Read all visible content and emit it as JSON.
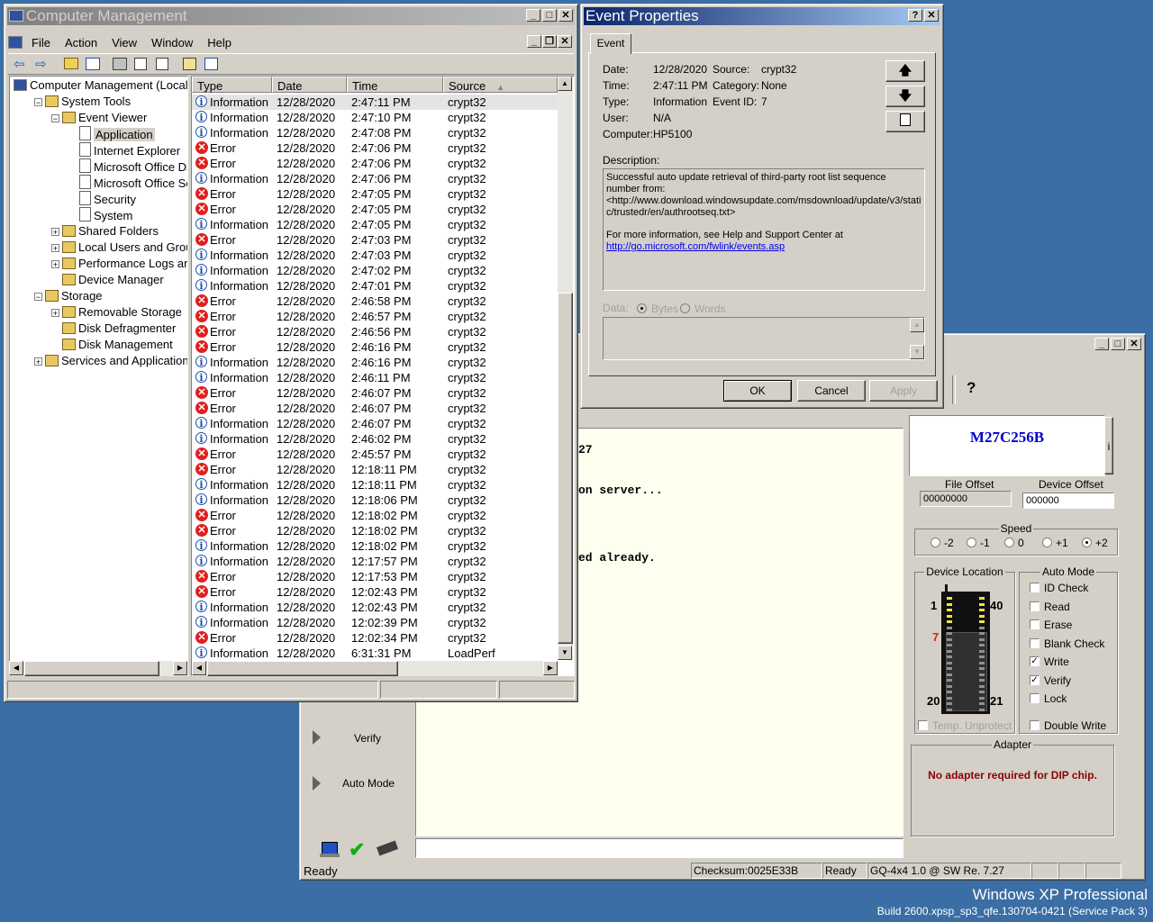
{
  "computer_management": {
    "title": "Computer Management",
    "menu": [
      "File",
      "Action",
      "View",
      "Window",
      "Help"
    ],
    "tree": [
      {
        "label": "Computer Management (Local",
        "level": 0,
        "exp": ""
      },
      {
        "label": "System Tools",
        "level": 1,
        "exp": "-"
      },
      {
        "label": "Event Viewer",
        "level": 2,
        "exp": "-"
      },
      {
        "label": "Application",
        "level": 3,
        "exp": "",
        "selected": true
      },
      {
        "label": "Internet Explorer",
        "level": 3,
        "exp": ""
      },
      {
        "label": "Microsoft Office Diag",
        "level": 3,
        "exp": ""
      },
      {
        "label": "Microsoft Office Sess",
        "level": 3,
        "exp": ""
      },
      {
        "label": "Security",
        "level": 3,
        "exp": ""
      },
      {
        "label": "System",
        "level": 3,
        "exp": ""
      },
      {
        "label": "Shared Folders",
        "level": 2,
        "exp": "+"
      },
      {
        "label": "Local Users and Groups",
        "level": 2,
        "exp": "+"
      },
      {
        "label": "Performance Logs and A",
        "level": 2,
        "exp": "+"
      },
      {
        "label": "Device Manager",
        "level": 2,
        "exp": ""
      },
      {
        "label": "Storage",
        "level": 1,
        "exp": "-"
      },
      {
        "label": "Removable Storage",
        "level": 2,
        "exp": "+"
      },
      {
        "label": "Disk Defragmenter",
        "level": 2,
        "exp": ""
      },
      {
        "label": "Disk Management",
        "level": 2,
        "exp": ""
      },
      {
        "label": "Services and Applications",
        "level": 1,
        "exp": "+"
      }
    ],
    "columns": [
      "Type",
      "Date",
      "Time",
      "Source"
    ],
    "events": [
      [
        "Information",
        "12/28/2020",
        "2:47:11 PM",
        "crypt32"
      ],
      [
        "Information",
        "12/28/2020",
        "2:47:10 PM",
        "crypt32"
      ],
      [
        "Information",
        "12/28/2020",
        "2:47:08 PM",
        "crypt32"
      ],
      [
        "Error",
        "12/28/2020",
        "2:47:06 PM",
        "crypt32"
      ],
      [
        "Error",
        "12/28/2020",
        "2:47:06 PM",
        "crypt32"
      ],
      [
        "Information",
        "12/28/2020",
        "2:47:06 PM",
        "crypt32"
      ],
      [
        "Error",
        "12/28/2020",
        "2:47:05 PM",
        "crypt32"
      ],
      [
        "Error",
        "12/28/2020",
        "2:47:05 PM",
        "crypt32"
      ],
      [
        "Information",
        "12/28/2020",
        "2:47:05 PM",
        "crypt32"
      ],
      [
        "Error",
        "12/28/2020",
        "2:47:03 PM",
        "crypt32"
      ],
      [
        "Information",
        "12/28/2020",
        "2:47:03 PM",
        "crypt32"
      ],
      [
        "Information",
        "12/28/2020",
        "2:47:02 PM",
        "crypt32"
      ],
      [
        "Information",
        "12/28/2020",
        "2:47:01 PM",
        "crypt32"
      ],
      [
        "Error",
        "12/28/2020",
        "2:46:58 PM",
        "crypt32"
      ],
      [
        "Error",
        "12/28/2020",
        "2:46:57 PM",
        "crypt32"
      ],
      [
        "Error",
        "12/28/2020",
        "2:46:56 PM",
        "crypt32"
      ],
      [
        "Error",
        "12/28/2020",
        "2:46:16 PM",
        "crypt32"
      ],
      [
        "Information",
        "12/28/2020",
        "2:46:16 PM",
        "crypt32"
      ],
      [
        "Information",
        "12/28/2020",
        "2:46:11 PM",
        "crypt32"
      ],
      [
        "Error",
        "12/28/2020",
        "2:46:07 PM",
        "crypt32"
      ],
      [
        "Error",
        "12/28/2020",
        "2:46:07 PM",
        "crypt32"
      ],
      [
        "Information",
        "12/28/2020",
        "2:46:07 PM",
        "crypt32"
      ],
      [
        "Information",
        "12/28/2020",
        "2:46:02 PM",
        "crypt32"
      ],
      [
        "Error",
        "12/28/2020",
        "2:45:57 PM",
        "crypt32"
      ],
      [
        "Error",
        "12/28/2020",
        "12:18:11 PM",
        "crypt32"
      ],
      [
        "Information",
        "12/28/2020",
        "12:18:11 PM",
        "crypt32"
      ],
      [
        "Information",
        "12/28/2020",
        "12:18:06 PM",
        "crypt32"
      ],
      [
        "Error",
        "12/28/2020",
        "12:18:02 PM",
        "crypt32"
      ],
      [
        "Error",
        "12/28/2020",
        "12:18:02 PM",
        "crypt32"
      ],
      [
        "Information",
        "12/28/2020",
        "12:18:02 PM",
        "crypt32"
      ],
      [
        "Information",
        "12/28/2020",
        "12:17:57 PM",
        "crypt32"
      ],
      [
        "Error",
        "12/28/2020",
        "12:17:53 PM",
        "crypt32"
      ],
      [
        "Error",
        "12/28/2020",
        "12:02:43 PM",
        "crypt32"
      ],
      [
        "Information",
        "12/28/2020",
        "12:02:43 PM",
        "crypt32"
      ],
      [
        "Information",
        "12/28/2020",
        "12:02:39 PM",
        "crypt32"
      ],
      [
        "Error",
        "12/28/2020",
        "12:02:34 PM",
        "crypt32"
      ],
      [
        "Information",
        "12/28/2020",
        "6:31:31 PM",
        "LoadPerf"
      ]
    ]
  },
  "event_properties": {
    "title": "Event Properties",
    "tab": "Event",
    "date_label": "Date:",
    "date": "12/28/2020",
    "source_label": "Source:",
    "source": "crypt32",
    "time_label": "Time:",
    "time": "2:47:11 PM",
    "category_label": "Category:",
    "category": "None",
    "type_label": "Type:",
    "type": "Information",
    "eventid_label": "Event ID:",
    "eventid": "7",
    "user_label": "User:",
    "user": "N/A",
    "computer_label": "Computer:",
    "computer": "HP5100",
    "description_label": "Description:",
    "description_1": "Successful auto update retrieval of third-party root list sequence number from:",
    "description_2": "<http://www.download.windowsupdate.com/msdownload/update/v3/static/trustedr/en/authrootseq.txt>",
    "description_3": "For more information, see Help and Support Center at",
    "description_link": "http://go.microsoft.com/fwlink/events.asp",
    "data_label": "Data:",
    "bytes_label": "Bytes",
    "words_label": "Words",
    "ok": "OK",
    "cancel": "Cancel",
    "apply": "Apply"
  },
  "programmer": {
    "device": "M27C256B",
    "console_lines": [
      "27",
      "on server...",
      "ed already."
    ],
    "file_offset_label": "File Offset",
    "file_offset": "00000000",
    "device_offset_label": "Device Offset",
    "device_offset": "000000",
    "speed_label": "Speed",
    "speeds": [
      "-2",
      "-1",
      "0",
      "+1",
      "+2"
    ],
    "speed_selected": "+2",
    "device_location_label": "Device Location",
    "pin_1": "1",
    "pin_40": "40",
    "pin_7": "7",
    "pin_20": "20",
    "pin_21": "21",
    "temp_unprotect": "Temp. Unprotect",
    "auto_mode_label": "Auto Mode",
    "auto_mode": [
      {
        "label": "ID Check",
        "checked": false
      },
      {
        "label": "Read",
        "checked": false
      },
      {
        "label": "Erase",
        "checked": false
      },
      {
        "label": "Blank Check",
        "checked": false
      },
      {
        "label": "Write",
        "checked": true
      },
      {
        "label": "Verify",
        "checked": true
      },
      {
        "label": "Lock",
        "checked": false
      }
    ],
    "double_write": "Double Write",
    "adapter_label": "Adapter",
    "adapter_msg": "No adapter required for DIP chip.",
    "side_verify": "Verify",
    "side_auto": "Auto Mode",
    "status_ready": "Ready",
    "checksum": "Checksum:0025E33B",
    "status_ready2": "Ready",
    "version": "GQ-4x4 1.0 @ SW Re. 7.27",
    "help_glyph": "?",
    "info_glyph": "i"
  },
  "desktop": {
    "os_name": "Windows XP Professional",
    "build": "Build 2600.xpsp_sp3_qfe.130704-0421 (Service Pack 3)"
  },
  "colors": {
    "desktop": "#3a6ea5",
    "face": "#d4d0c8",
    "device_blue": "#0000cc",
    "adapter_red": "#8b0000"
  }
}
